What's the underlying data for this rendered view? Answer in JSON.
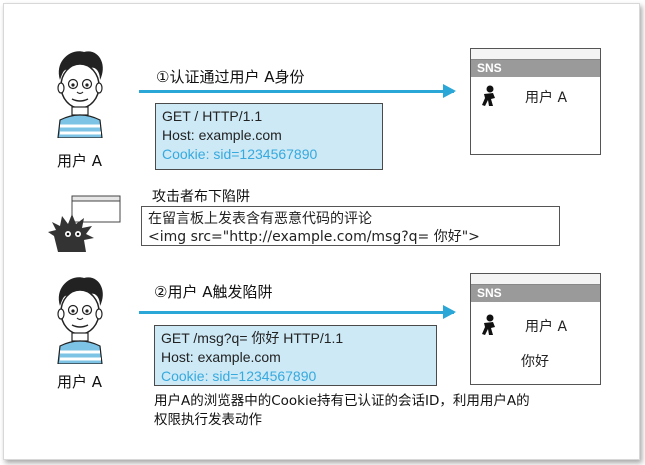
{
  "step1": {
    "label": "①认证通过用户 A身份",
    "person_label": "用户 A",
    "request": {
      "line1": "GET / HTTP/1.1",
      "line2": "Host: example.com",
      "line3": "Cookie: sid=1234567890"
    },
    "browser": {
      "bar": "SNS",
      "user": "用户 A"
    }
  },
  "attacker": {
    "label": "攻击者布下陷阱",
    "comment_line1": "在留言板上发表含有恶意代码的评论",
    "comment_line2": "<img src=\"http://example.com/msg?q= 你好\">"
  },
  "step2": {
    "label": "②用户 A触发陷阱",
    "person_label": "用户 A",
    "request": {
      "line1": "GET /msg?q= 你好 HTTP/1.1",
      "line2": "Host: example.com",
      "line3": "Cookie: sid=1234567890"
    },
    "browser": {
      "bar": "SNS",
      "user": "用户 A",
      "message": "你好"
    }
  },
  "caption": {
    "line1": "用户A的浏览器中的Cookie持有已认证的会话ID，利用用户A的",
    "line2": "权限执行发表动作"
  },
  "colors": {
    "arrow": "#2aa7d6",
    "request_bg": "#cde9f6",
    "cookie_text": "#36a9de"
  }
}
